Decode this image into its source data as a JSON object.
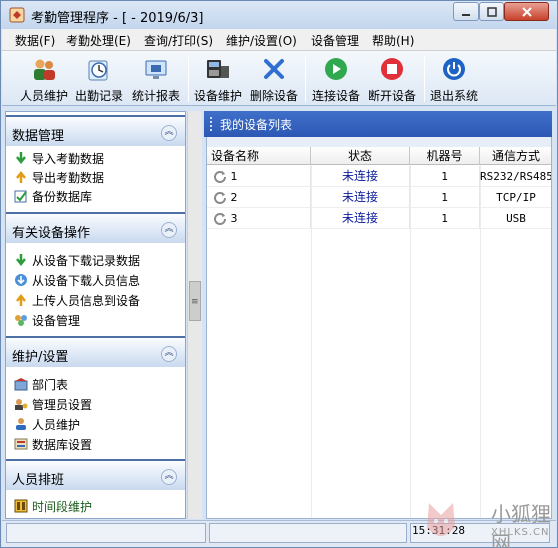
{
  "window": {
    "title": "考勤管理程序 - [ - 2019/6/3]"
  },
  "menu": [
    "数据(F)",
    "考勤处理(E)",
    "查询/打印(S)",
    "维护/设置(O)",
    "设备管理",
    "帮助(H)"
  ],
  "toolbar": [
    {
      "label": "人员维护",
      "icon": "users-icon"
    },
    {
      "label": "出勤记录",
      "icon": "clock-icon"
    },
    {
      "label": "统计报表",
      "icon": "report-icon"
    },
    {
      "label": "设备维护",
      "icon": "device-icon"
    },
    {
      "label": "删除设备",
      "icon": "delete-icon"
    },
    {
      "label": "连接设备",
      "icon": "connect-icon"
    },
    {
      "label": "断开设备",
      "icon": "disconnect-icon"
    },
    {
      "label": "退出系统",
      "icon": "power-icon"
    }
  ],
  "sidebar": {
    "groups": [
      {
        "title": "数据管理",
        "items": [
          "导入考勤数据",
          "导出考勤数据",
          "备份数据库"
        ]
      },
      {
        "title": "有关设备操作",
        "items": [
          "从设备下载记录数据",
          "从设备下载人员信息",
          "上传人员信息到设备",
          "设备管理"
        ]
      },
      {
        "title": "维护/设置",
        "items": [
          "部门表",
          "管理员设置",
          "人员维护",
          "数据库设置"
        ]
      },
      {
        "title": "人员排班",
        "items": [
          "时间段维护"
        ]
      }
    ]
  },
  "device_panel": {
    "title": "我的设备列表",
    "columns": [
      "设备名称",
      "状态",
      "机器号",
      "通信方式"
    ],
    "rows": [
      {
        "name": "1",
        "status": "未连接",
        "machine": "1",
        "comm": "RS232/RS485"
      },
      {
        "name": "2",
        "status": "未连接",
        "machine": "1",
        "comm": "TCP/IP"
      },
      {
        "name": "3",
        "status": "未连接",
        "machine": "1",
        "comm": "USB"
      }
    ]
  },
  "statusbar": {
    "time": "15:31:28"
  },
  "watermark": {
    "cn": "小狐狸网",
    "en": "XHLKS.CN"
  },
  "colors": {
    "accent": "#2c58b4",
    "status_text": "#0b1b9b",
    "frame": "#d6e3f3"
  }
}
